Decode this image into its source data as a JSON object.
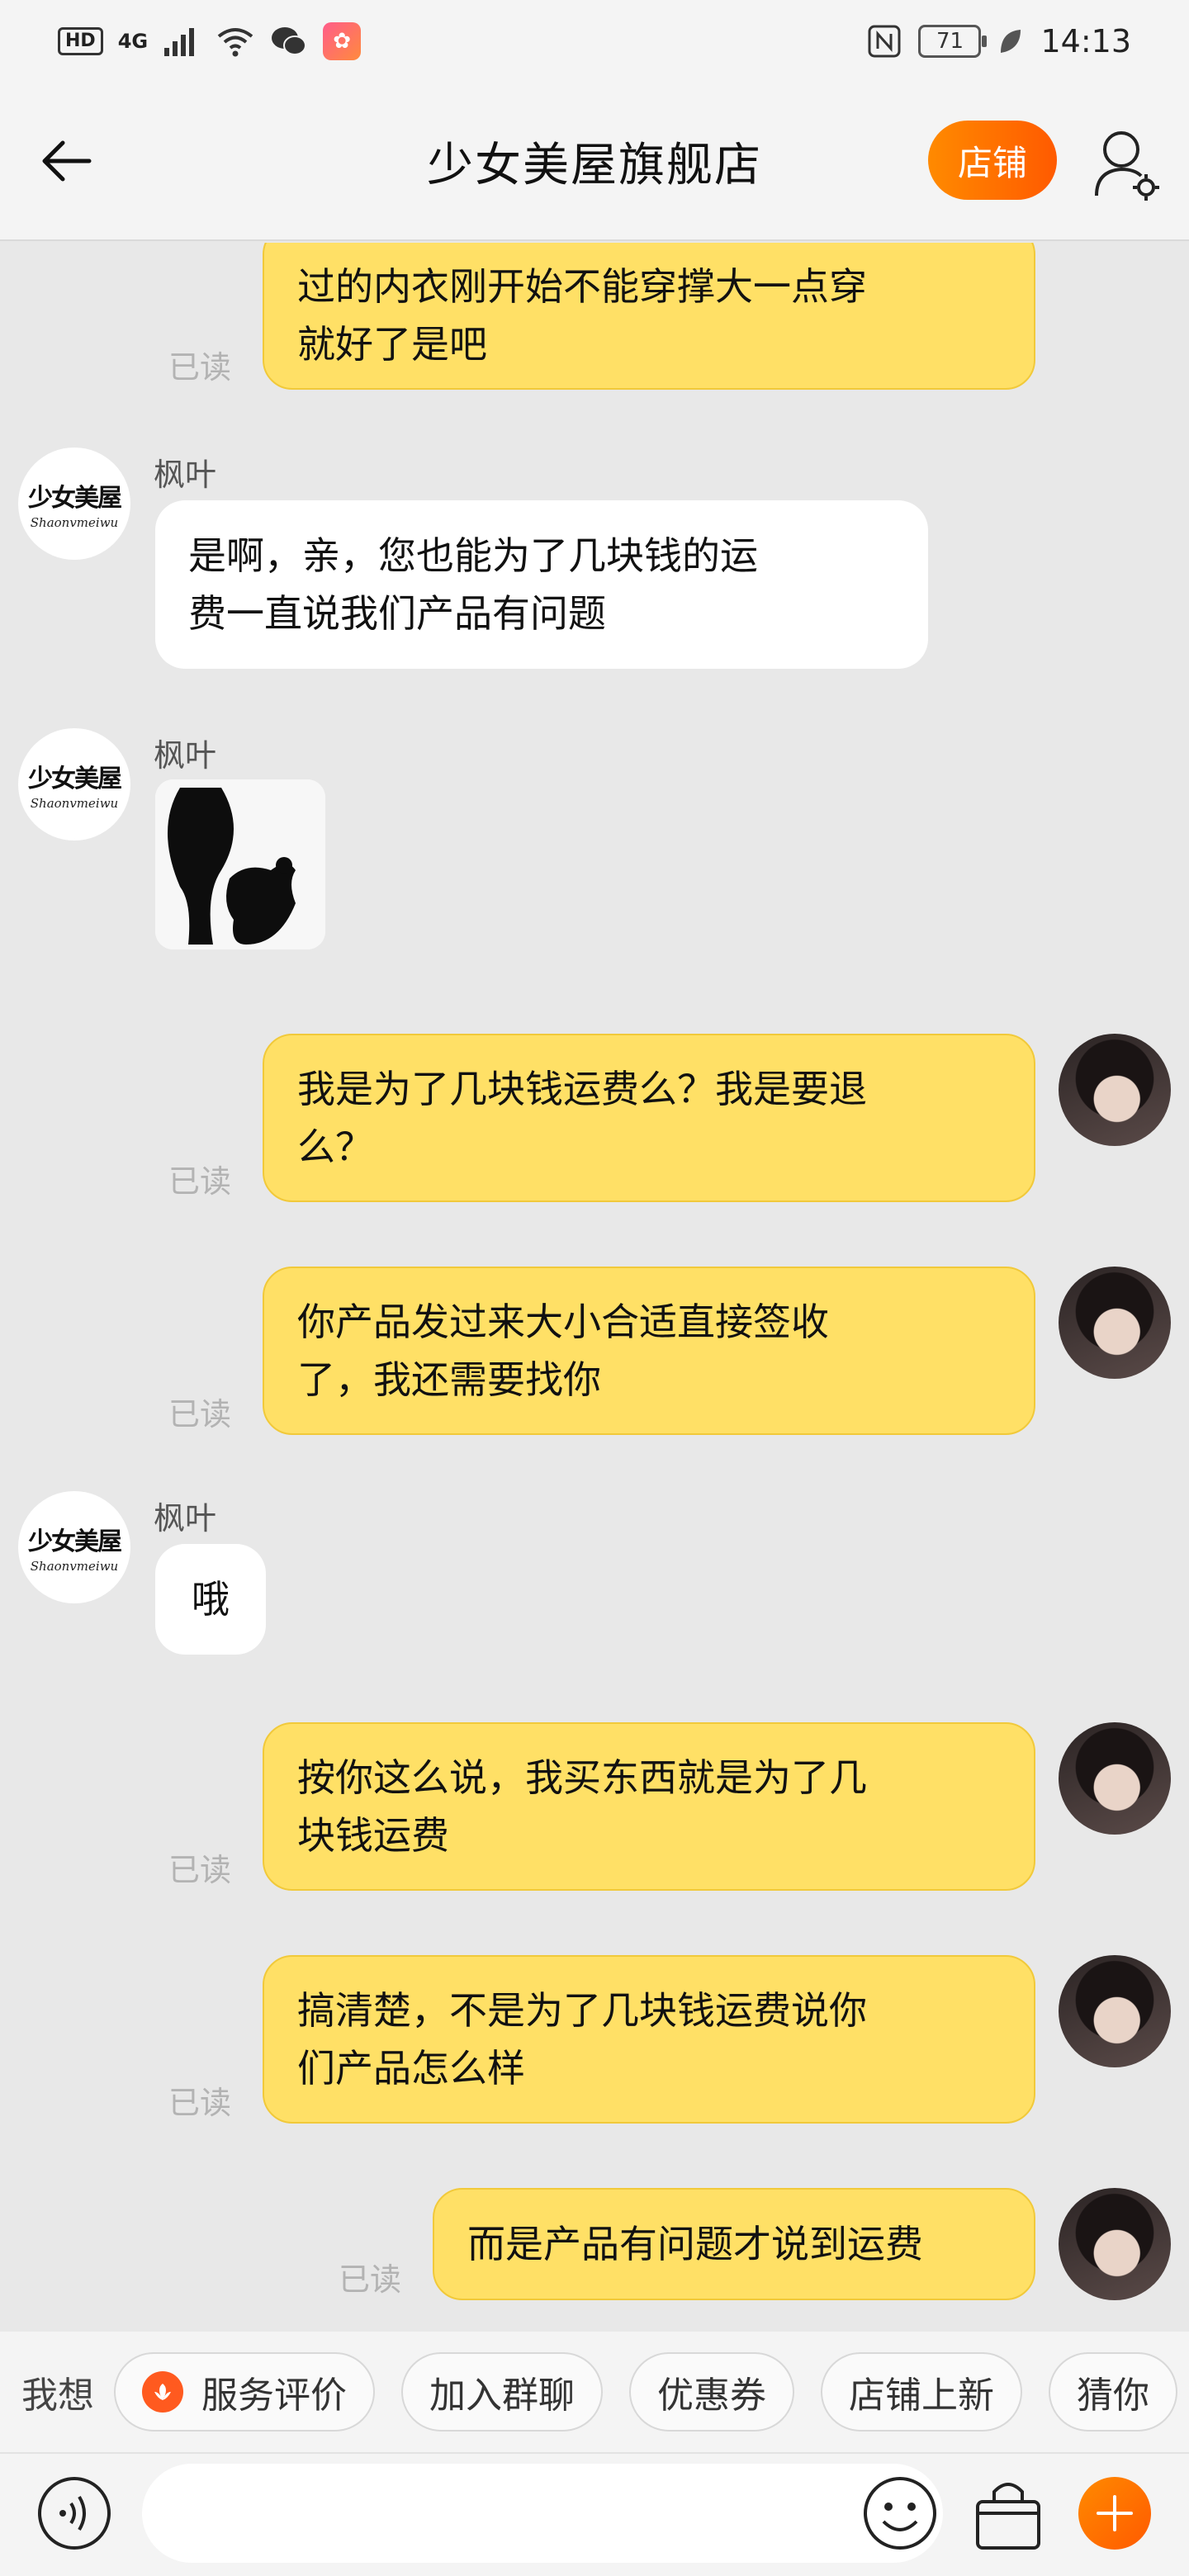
{
  "status_bar": {
    "left_chips": [
      "HD",
      "4G"
    ],
    "battery": "71",
    "time": "14:13"
  },
  "header": {
    "title": "少女美屋旗舰店",
    "shop_button": "店铺"
  },
  "messages": [
    {
      "side": "me",
      "text_lines": [
        "过的内衣刚开始不能穿撑大一点穿",
        "就好了是吧"
      ],
      "read": "已读"
    },
    {
      "side": "them",
      "sender": "枫叶",
      "text_lines": [
        "是啊，亲，您也能为了几块钱的运",
        "费一直说我们产品有问题"
      ]
    },
    {
      "side": "them",
      "sender": "枫叶",
      "sticker": true
    },
    {
      "side": "me",
      "text_lines": [
        "我是为了几块钱运费么？我是要退",
        "么？"
      ],
      "read": "已读"
    },
    {
      "side": "me",
      "text_lines": [
        "你产品发过来大小合适直接签收",
        "了，我还需要找你"
      ],
      "read": "已读"
    },
    {
      "side": "them",
      "sender": "枫叶",
      "text_lines": [
        "哦"
      ]
    },
    {
      "side": "me",
      "text_lines": [
        "按你这么说，我买东西就是为了几",
        "块钱运费"
      ],
      "read": "已读"
    },
    {
      "side": "me",
      "text_lines": [
        "搞清楚，不是为了几块钱运费说你",
        "们产品怎么样"
      ],
      "read": "已读"
    },
    {
      "side": "me",
      "text_lines": [
        "而是产品有问题才说到运费"
      ],
      "read": "已读"
    }
  ],
  "shop_avatar": {
    "logo_cn": "少女美屋",
    "logo_en": "Shaonvmeiwu"
  },
  "quick_bar": {
    "label": "我想",
    "chips": [
      "服务评价",
      "加入群聊",
      "优惠券",
      "店铺上新",
      "猜你"
    ]
  },
  "input": {
    "placeholder": ""
  },
  "colors": {
    "accent": "#ff6a00",
    "my_bubble": "#ffe066",
    "their_bubble": "#ffffff"
  }
}
